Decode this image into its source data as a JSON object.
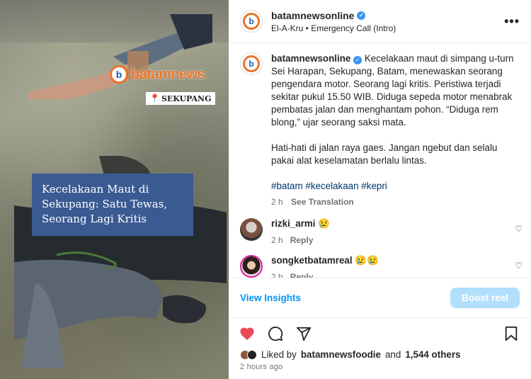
{
  "media": {
    "watermark_brand": "batamnews",
    "location_tag": "SEKUPANG",
    "headline": "Kecelakaan Maut di Sekupang: Satu Tewas, Seorang Lagi Kritis"
  },
  "post_header": {
    "username": "batamnewsonline",
    "audio": "El-A-Kru • Emergency Call (Intro)",
    "more_label": "•••"
  },
  "caption": {
    "username": "batamnewsonline",
    "paragraph1": "Kecelakaan maut di simpang u-turn Sei Harapan, Sekupang, Batam, menewaskan seorang pengendara motor. Seorang lagi kritis. Peristiwa terjadi sekitar pukul 15.50 WIB. Diduga sepeda motor menabrak pembatas jalan dan menghantam pohon. “Diduga rem blong,” ujar seorang saksi mata.",
    "paragraph2": "Hati-hati di jalan raya gaes. Jangan ngebut dan selalu pakai alat keselamatan berlalu lintas.",
    "hashtags": "#batam #kecelakaan #kepri",
    "time": "2 h",
    "see_translation": "See Translation"
  },
  "comments": [
    {
      "username": "rizki_armi",
      "text": "😢",
      "time": "2 h",
      "reply": "Reply"
    },
    {
      "username": "songketbatamreal",
      "text": "😢😢",
      "time": "2 h",
      "reply": "Reply"
    }
  ],
  "footer": {
    "view_insights": "View Insights",
    "boost_reel": "Boost reel",
    "liked_by_prefix": "Liked by",
    "liked_by_user": "batamnewsfoodie",
    "liked_by_and": "and",
    "liked_by_others": "1,544 others",
    "posted_ago": "2 hours ago"
  },
  "colors": {
    "accent": "#0095f6",
    "boost_disabled": "#b2dffc",
    "like_red": "#ed4956",
    "headline_box": "#3a5a92",
    "brand_orange": "#e8742a"
  }
}
